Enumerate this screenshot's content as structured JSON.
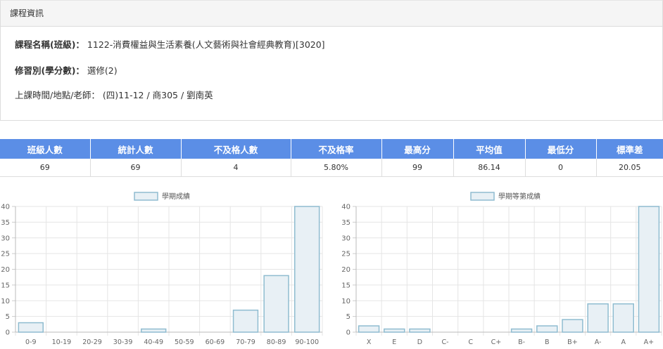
{
  "panel": {
    "title": "課程資訊"
  },
  "course": {
    "name_label": "課程名稱(班級)：",
    "name_value": "1122-消費權益與生活素養(人文藝術與社會經典教育)[3020]",
    "type_label": "修習別(學分數)：",
    "type_value": "選修(2)",
    "time_label": "上課時間/地點/老師：",
    "time_value": "(四)11-12 / 商305 / 劉南英"
  },
  "stats": {
    "headers": [
      "班級人數",
      "統計人數",
      "不及格人數",
      "不及格率",
      "最高分",
      "平均值",
      "最低分",
      "標準差"
    ],
    "values": [
      "69",
      "69",
      "4",
      "5.80%",
      "99",
      "86.14",
      "0",
      "20.05"
    ]
  },
  "colors": {
    "header_bg": "#5b8ee6",
    "bar_fill": "#e8f0f5",
    "bar_stroke": "#8fbcd0"
  },
  "chart_data": [
    {
      "type": "bar",
      "legend": "學期成績",
      "legend_position": "top",
      "categories": [
        "0-9",
        "10-19",
        "20-29",
        "30-39",
        "40-49",
        "50-59",
        "60-69",
        "70-79",
        "80-89",
        "90-100"
      ],
      "values": [
        3,
        0,
        0,
        0,
        1,
        0,
        0,
        7,
        18,
        40
      ],
      "ylim": [
        0,
        40
      ],
      "yticks": [
        0,
        5,
        10,
        15,
        20,
        25,
        30,
        35,
        40
      ],
      "grid": true
    },
    {
      "type": "bar",
      "legend": "學期等第成績",
      "legend_position": "top",
      "categories": [
        "X",
        "E",
        "D",
        "C-",
        "C",
        "C+",
        "B-",
        "B",
        "B+",
        "A-",
        "A",
        "A+"
      ],
      "values": [
        2,
        1,
        1,
        0,
        0,
        0,
        1,
        2,
        4,
        9,
        9,
        40
      ],
      "ylim": [
        0,
        40
      ],
      "yticks": [
        0,
        5,
        10,
        15,
        20,
        25,
        30,
        35,
        40
      ],
      "grid": true
    }
  ]
}
